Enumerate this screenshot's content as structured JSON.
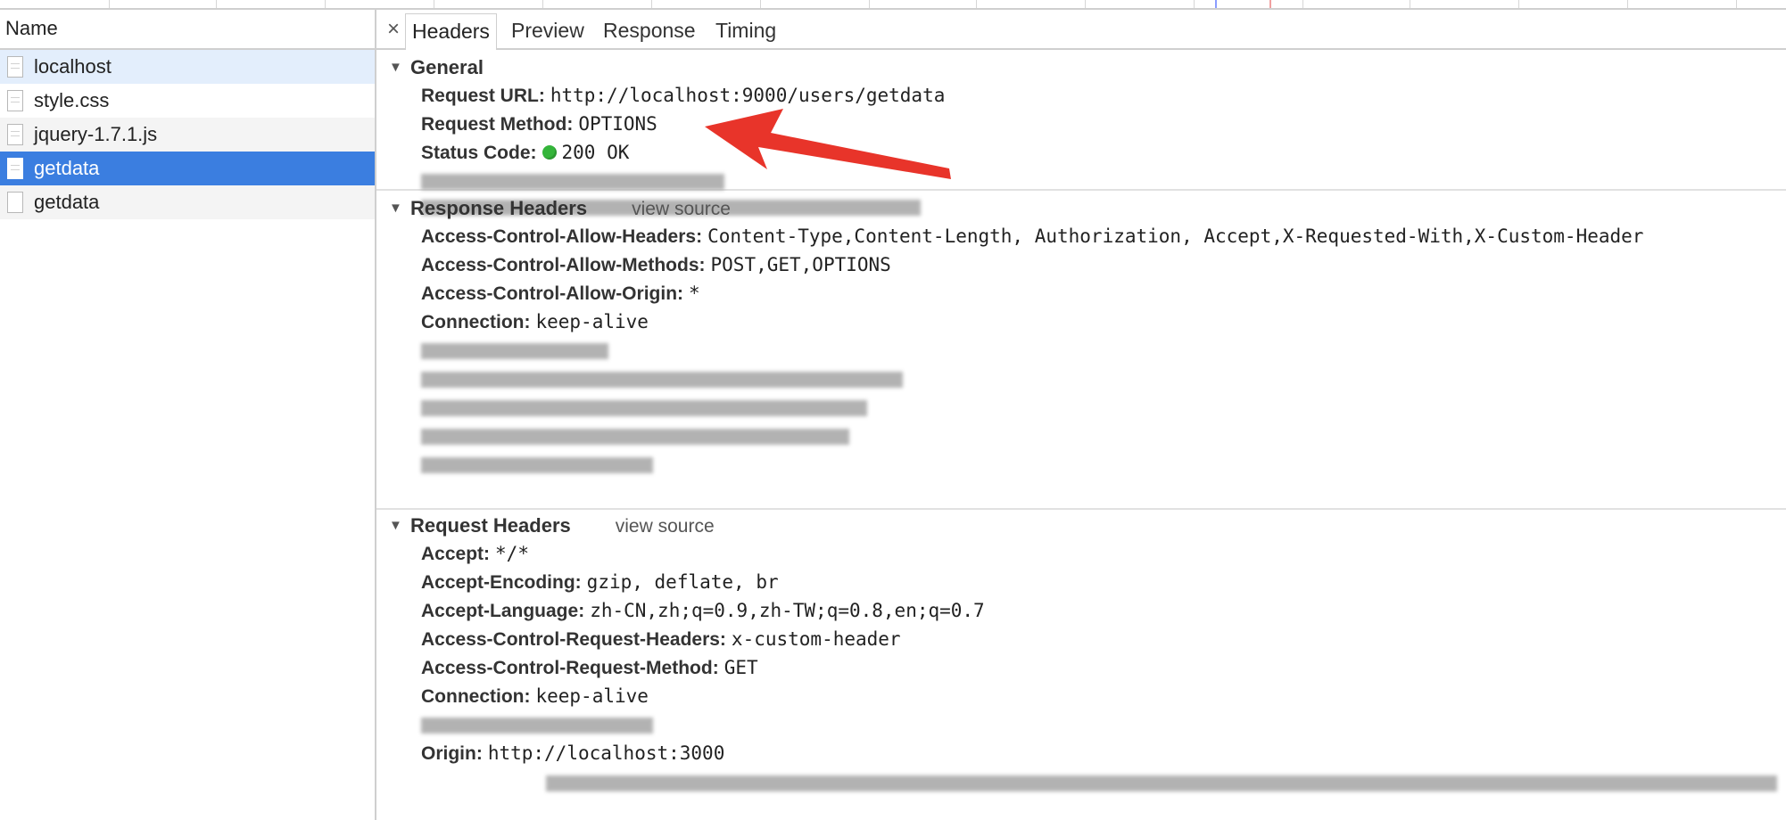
{
  "list": {
    "header": "Name",
    "requests": [
      "localhost",
      "style.css",
      "jquery-1.7.1.js",
      "getdata",
      "getdata"
    ]
  },
  "tabs": {
    "close": "×",
    "items": [
      "Headers",
      "Preview",
      "Response",
      "Timing"
    ]
  },
  "general": {
    "title": "General",
    "request_url_label": "Request URL:",
    "request_url": "http://localhost:9000/users/getdata",
    "request_method_label": "Request Method:",
    "request_method": "OPTIONS",
    "status_code_label": "Status Code:",
    "status_code": "200 OK"
  },
  "response_headers": {
    "title": "Response Headers",
    "view_source": "view source",
    "rows": [
      {
        "key": "Access-Control-Allow-Headers:",
        "value": "Content-Type,Content-Length, Authorization, Accept,X-Requested-With,X-Custom-Header"
      },
      {
        "key": "Access-Control-Allow-Methods:",
        "value": "POST,GET,OPTIONS"
      },
      {
        "key": "Access-Control-Allow-Origin:",
        "value": "*"
      },
      {
        "key": "Connection:",
        "value": "keep-alive"
      }
    ]
  },
  "request_headers": {
    "title": "Request Headers",
    "view_source": "view source",
    "rows": [
      {
        "key": "Accept:",
        "value": "*/*"
      },
      {
        "key": "Accept-Encoding:",
        "value": "gzip, deflate, br"
      },
      {
        "key": "Accept-Language:",
        "value": "zh-CN,zh;q=0.9,zh-TW;q=0.8,en;q=0.7"
      },
      {
        "key": "Access-Control-Request-Headers:",
        "value": "x-custom-header"
      },
      {
        "key": "Access-Control-Request-Method:",
        "value": "GET"
      },
      {
        "key": "Connection:",
        "value": "keep-alive"
      }
    ],
    "origin_label": "Origin:",
    "origin": "http://localhost:3000"
  },
  "colors": {
    "selected_row": "#3b7ee0",
    "status_ok": "#34b53a",
    "arrow": "#e8342a"
  }
}
